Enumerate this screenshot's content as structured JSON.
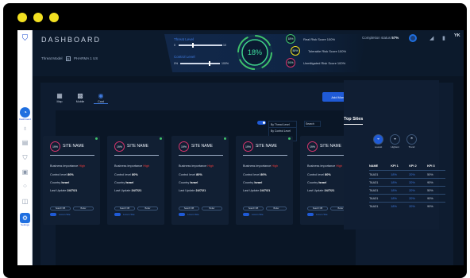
{
  "header": {
    "title": "DASHBOARD",
    "threat_model_label": "Threat Model",
    "threat_model_box": "☰",
    "threat_model_value": "PHARMA 1 US"
  },
  "threat": {
    "label": "Threat Level",
    "min": "0",
    "max": "10"
  },
  "control": {
    "label": "Control Level",
    "min": "0%",
    "max": "100%"
  },
  "gauge": {
    "value": "18%"
  },
  "risks": [
    {
      "pct": "18%",
      "label": "Real Risk Score 100%"
    },
    {
      "pct": "50%",
      "label": "Tolerable Risk Score 100%"
    },
    {
      "pct": "91%",
      "label": "Unmitigated Risk Score 100%"
    }
  ],
  "completion": {
    "label": "Completion status",
    "value": "57%"
  },
  "user": {
    "initials": "YK"
  },
  "rail": {
    "dashboard_label": "Dashboard",
    "settings_label": "Settings"
  },
  "views": [
    {
      "label": "Map",
      "icon": "map-icon"
    },
    {
      "label": "Mobile",
      "icon": "grid-icon"
    },
    {
      "label": "Card",
      "icon": "card-icon"
    }
  ],
  "add_button": "Add More Site",
  "content": {
    "toggle_label": "Ceriso cant rate",
    "sort_label": "By Threat Level",
    "sort_options": [
      "By Control Level",
      "By worse trial"
    ],
    "search_label": "Search"
  },
  "cards": [
    {
      "pct": "19%",
      "name": "SITE NAME",
      "business": "Business importance",
      "business_val": "High",
      "control": "Control level",
      "control_val": "80%",
      "country": "Country",
      "country_val": "Israel",
      "updated": "Last Update",
      "updated_val": "24/7/21",
      "b1": "Search DB",
      "b2": "Better",
      "toggle": "Lorem Site"
    },
    {
      "pct": "19%",
      "name": "SITE NAME",
      "business": "Business importance",
      "business_val": "High",
      "control": "Control level",
      "control_val": "80%",
      "country": "Country",
      "country_val": "Israel",
      "updated": "Last Update",
      "updated_val": "24/7/21",
      "b1": "Search DB",
      "b2": "Better",
      "toggle": "Lorem Site"
    },
    {
      "pct": "19%",
      "name": "SITE NAME",
      "business": "Business importance",
      "business_val": "High",
      "control": "Control level",
      "control_val": "80%",
      "country": "Country",
      "country_val": "Israel",
      "updated": "Last Update",
      "updated_val": "24/7/21",
      "b1": "Search DB",
      "b2": "Better",
      "toggle": "Lorem Site"
    },
    {
      "pct": "19%",
      "name": "SITE NAME",
      "business": "Business importance",
      "business_val": "High",
      "control": "Control level",
      "control_val": "80%",
      "country": "Country",
      "country_val": "Israel",
      "updated": "Last Update",
      "updated_val": "24/7/21",
      "b1": "Search DB",
      "b2": "Better",
      "toggle": "Lorem Site"
    },
    {
      "pct": "19%",
      "name": "SITE NAME",
      "business": "Business importance",
      "business_val": "High",
      "control": "Control level",
      "control_val": "80%",
      "country": "Country",
      "country_val": "Israel",
      "updated": "Last Update",
      "updated_val": "24/7/21",
      "b1": "Search DB",
      "b2": "Better",
      "toggle": "Lorem Site"
    }
  ],
  "top_sites": {
    "title": "Top Sites",
    "filters": [
      {
        "label": "Lowest",
        "icon": "gauge-icon"
      },
      {
        "label": "Highest",
        "icon": "gauge-icon"
      },
      {
        "label": "Trend",
        "icon": "trend-icon"
      }
    ],
    "columns": [
      "NAME",
      "KPI 1",
      "KPI 2",
      "KPI 3"
    ],
    "rows": [
      [
        "TAA31",
        "18%",
        "20%",
        "50%"
      ],
      [
        "TAA31",
        "18%",
        "20%",
        "90%"
      ],
      [
        "TAA31",
        "18%",
        "20%",
        "50%"
      ],
      [
        "TAA31",
        "18%",
        "20%",
        "90%"
      ],
      [
        "TAA31",
        "18%",
        "20%",
        "90%"
      ]
    ]
  }
}
